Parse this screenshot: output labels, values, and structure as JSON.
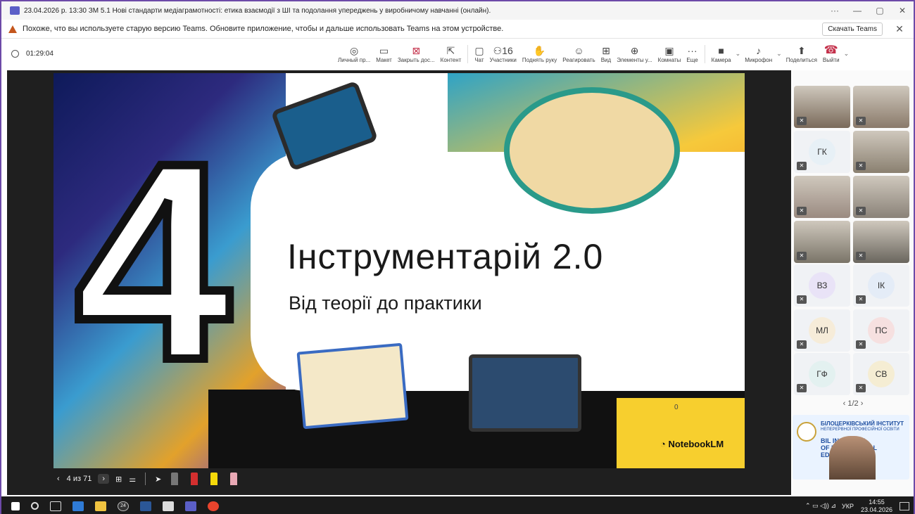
{
  "window": {
    "title": "23.04.2026 р. 13:30 ЗМ 5.1 Нові стандарти медіаграмотності: етика взаємодії з ШІ та подолання упереджень у виробничому навчанні (онлайн).",
    "more": "···",
    "minimize": "—",
    "maximize": "▢",
    "close": "✕"
  },
  "banner": {
    "message": "Похоже, что вы используете старую версию Teams. Обновите приложение, чтобы и дальше использовать Teams на этом устройстве.",
    "download": "Скачать Teams",
    "close": "✕"
  },
  "meeting": {
    "elapsed": "01:29:04"
  },
  "toolbar": [
    {
      "label": "Личный пр...",
      "icon": "eye-icon",
      "glyph": "◎"
    },
    {
      "label": "Макет",
      "icon": "layout-icon",
      "glyph": "▭"
    },
    {
      "label": "Закрыть дос...",
      "icon": "stop-share-icon",
      "glyph": "⊠"
    },
    {
      "label": "Контент",
      "icon": "content-icon",
      "glyph": "⇱"
    },
    {
      "label": "Чат",
      "icon": "chat-icon",
      "glyph": "▢"
    },
    {
      "label": "Участники",
      "icon": "participants-icon",
      "glyph": "⚇16"
    },
    {
      "label": "Поднять руку",
      "icon": "hand-icon",
      "glyph": "✋"
    },
    {
      "label": "Реагировать",
      "icon": "smiley-icon",
      "glyph": "☺"
    },
    {
      "label": "Вид",
      "icon": "view-icon",
      "glyph": "⊞"
    },
    {
      "label": "Элементы у...",
      "icon": "apps-icon",
      "glyph": "⊕"
    },
    {
      "label": "Комнаты",
      "icon": "rooms-icon",
      "glyph": "▣"
    },
    {
      "label": "Еще",
      "icon": "more-icon",
      "glyph": "···"
    },
    {
      "label": "Камера",
      "icon": "camera-icon",
      "glyph": "■"
    },
    {
      "label": "Микрофон",
      "icon": "mic-icon",
      "glyph": "♪"
    },
    {
      "label": "Поделиться",
      "icon": "share-icon",
      "glyph": "⬆"
    },
    {
      "label": "Выйти",
      "icon": "hangup-icon",
      "glyph": "☎"
    }
  ],
  "slide": {
    "number": "4",
    "title": "Інструментарій 2.0",
    "subtitle": "Від теорії до практики",
    "brand": "NotebookLM",
    "mark": "0"
  },
  "slide_controls": {
    "prev": "‹",
    "counter": "4 из 71",
    "next": "›",
    "grid": "⊞",
    "settings": "⚌",
    "pointer": "➤"
  },
  "participants": [
    {
      "initials": "",
      "bg": "#7a6a5a"
    },
    {
      "initials": "",
      "bg": "#8a7a6a"
    },
    {
      "initials": "ГК",
      "bg": "#e7f0f6"
    },
    {
      "initials": "",
      "bg": "#8a8070"
    },
    {
      "initials": "",
      "bg": "#9a8a80"
    },
    {
      "initials": "",
      "bg": "#8a8278"
    },
    {
      "initials": "",
      "bg": "#7a7468"
    },
    {
      "initials": "",
      "bg": "#6a665e"
    },
    {
      "initials": "ВЗ",
      "bg": "#e9e3f7"
    },
    {
      "initials": "ІК",
      "bg": "#e4ecf7"
    },
    {
      "initials": "МЛ",
      "bg": "#f6ecd9"
    },
    {
      "initials": "ПС",
      "bg": "#f6e0e0"
    },
    {
      "initials": "ГФ",
      "bg": "#e3f1f0"
    },
    {
      "initials": "СВ",
      "bg": "#f5edd3"
    }
  ],
  "pager": {
    "prev": "‹",
    "text": "1/2",
    "next": "›"
  },
  "share_preview": {
    "line1": "БІЛОЦЕРКІВСЬКИЙ ІНСТИТУТ",
    "line2": "НЕПЕРЕРВНОЇ ПРОФЕСІЙНОЇ ОСВІТИ",
    "line3": "BIL     INSTITUTE",
    "line4": "OF      ROFESSIONAL",
    "line5": "ED"
  },
  "taskbar": {
    "lang": "УКР",
    "time": "14:55",
    "date": "23.04.2026",
    "badge": "24"
  }
}
